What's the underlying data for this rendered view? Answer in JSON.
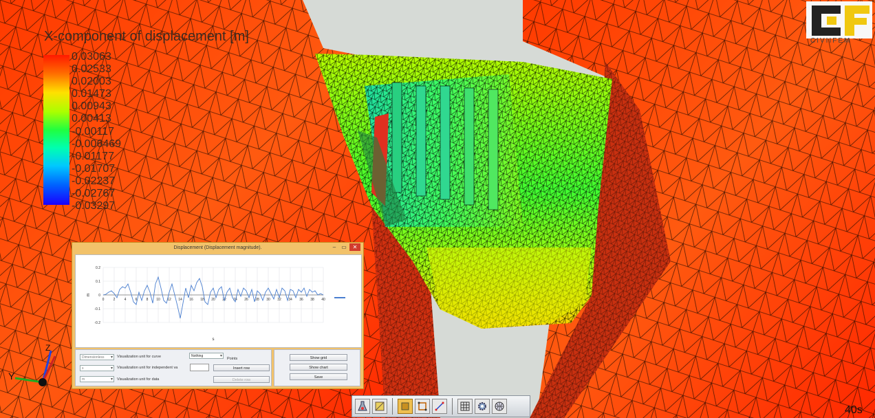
{
  "colorbar": {
    "title": "X-component of displacement [m]",
    "labels": [
      "0.03063",
      "0.02533",
      "0.02003",
      "0.01473",
      "0.00943",
      "0.00413",
      "-0.00117",
      "-0.006469",
      "-0.01177",
      "-0.01707",
      "-0.02237",
      "-0.02767",
      "-0.03297"
    ]
  },
  "logo": {
    "text": "CIVIIFEM",
    "icon": "civilfem-logo"
  },
  "time_label": "40s",
  "axes": {
    "y": "Y",
    "z": "Z",
    "colors": {
      "y": "#22aa22",
      "z": "#2244dd",
      "x": "#cc2222"
    }
  },
  "dialog": {
    "title": "Displacement (Displacement magnitude).",
    "controls": {
      "minimize": "–",
      "maximize": "▭",
      "close": "✕"
    },
    "left_panel": {
      "combo_curve": "Dimensionless",
      "label_curve": "Visualization unit for curve",
      "combo_points": "Nothing",
      "label_points": "Points",
      "combo_independent": "s",
      "label_independent": "Visualization unit for independent va",
      "insert_row": "Insert row",
      "combo_data": "m",
      "label_data": "Visualization unit for data",
      "delete_row": "Delete row"
    },
    "right_panel": {
      "show_grid": "Show grid",
      "show_chart": "Show chart",
      "save": "Save"
    }
  },
  "chart_data": {
    "type": "line",
    "xlabel": "s",
    "ylabel": "m",
    "xlim": [
      0,
      40
    ],
    "ylim": [
      -0.2,
      0.2
    ],
    "x_ticks": [
      "0",
      "2",
      "4",
      "6",
      "8",
      "10",
      "12",
      "14",
      "16",
      "18",
      "20",
      "22",
      "24",
      "26",
      "28",
      "30",
      "32",
      "34",
      "36",
      "38",
      "40"
    ],
    "y_ticks": [
      "0.2",
      "0.1",
      "0",
      "-0.1",
      "-0.2"
    ],
    "series": [
      {
        "color": "#4a7fd0",
        "x": [
          0,
          0.5,
          1,
          1.5,
          2,
          2.5,
          3,
          3.5,
          4,
          4.5,
          5,
          5.5,
          6,
          6.5,
          7,
          7.5,
          8,
          8.5,
          9,
          9.5,
          10,
          10.5,
          11,
          11.5,
          12,
          12.5,
          13,
          13.5,
          14,
          14.5,
          15,
          15.5,
          16,
          16.5,
          17,
          17.5,
          18,
          18.5,
          19,
          19.5,
          20,
          20.5,
          21,
          21.5,
          22,
          22.5,
          23,
          23.5,
          24,
          24.5,
          25,
          25.5,
          26,
          26.5,
          27,
          27.5,
          28,
          28.5,
          29,
          29.5,
          30,
          30.5,
          31,
          31.5,
          32,
          32.5,
          33,
          33.5,
          34,
          34.5,
          35,
          35.5,
          36,
          36.5,
          37,
          37.5,
          38,
          38.5,
          39,
          39.5,
          40
        ],
        "values": [
          0,
          0.005,
          0.02,
          0.03,
          0.01,
          -0.02,
          0.04,
          0.06,
          0.05,
          0.08,
          0.02,
          -0.05,
          -0.07,
          0.02,
          -0.04,
          0.03,
          0.07,
          0.02,
          -0.06,
          0.08,
          0.13,
          0.05,
          -0.04,
          -0.06,
          0.02,
          0.08,
          0.0,
          -0.08,
          -0.17,
          -0.06,
          0.05,
          -0.02,
          0.07,
          0.03,
          0.09,
          0.12,
          0.06,
          -0.05,
          -0.07,
          0.02,
          0.05,
          -0.02,
          0.04,
          0.06,
          -0.04,
          0.02,
          0.05,
          -0.02,
          -0.05,
          0.04,
          -0.01,
          0.05,
          0.03,
          -0.02,
          0.04,
          -0.05,
          0.03,
          0.01,
          -0.04,
          0.02,
          0.05,
          0.01,
          -0.03,
          0.04,
          -0.02,
          0.05,
          0.03,
          -0.04,
          0.04,
          0.03,
          -0.02,
          0.04,
          0.02,
          0.05,
          -0.01,
          0.04,
          0.02,
          0.03,
          0.0,
          0.01,
          0
        ]
      }
    ]
  }
}
